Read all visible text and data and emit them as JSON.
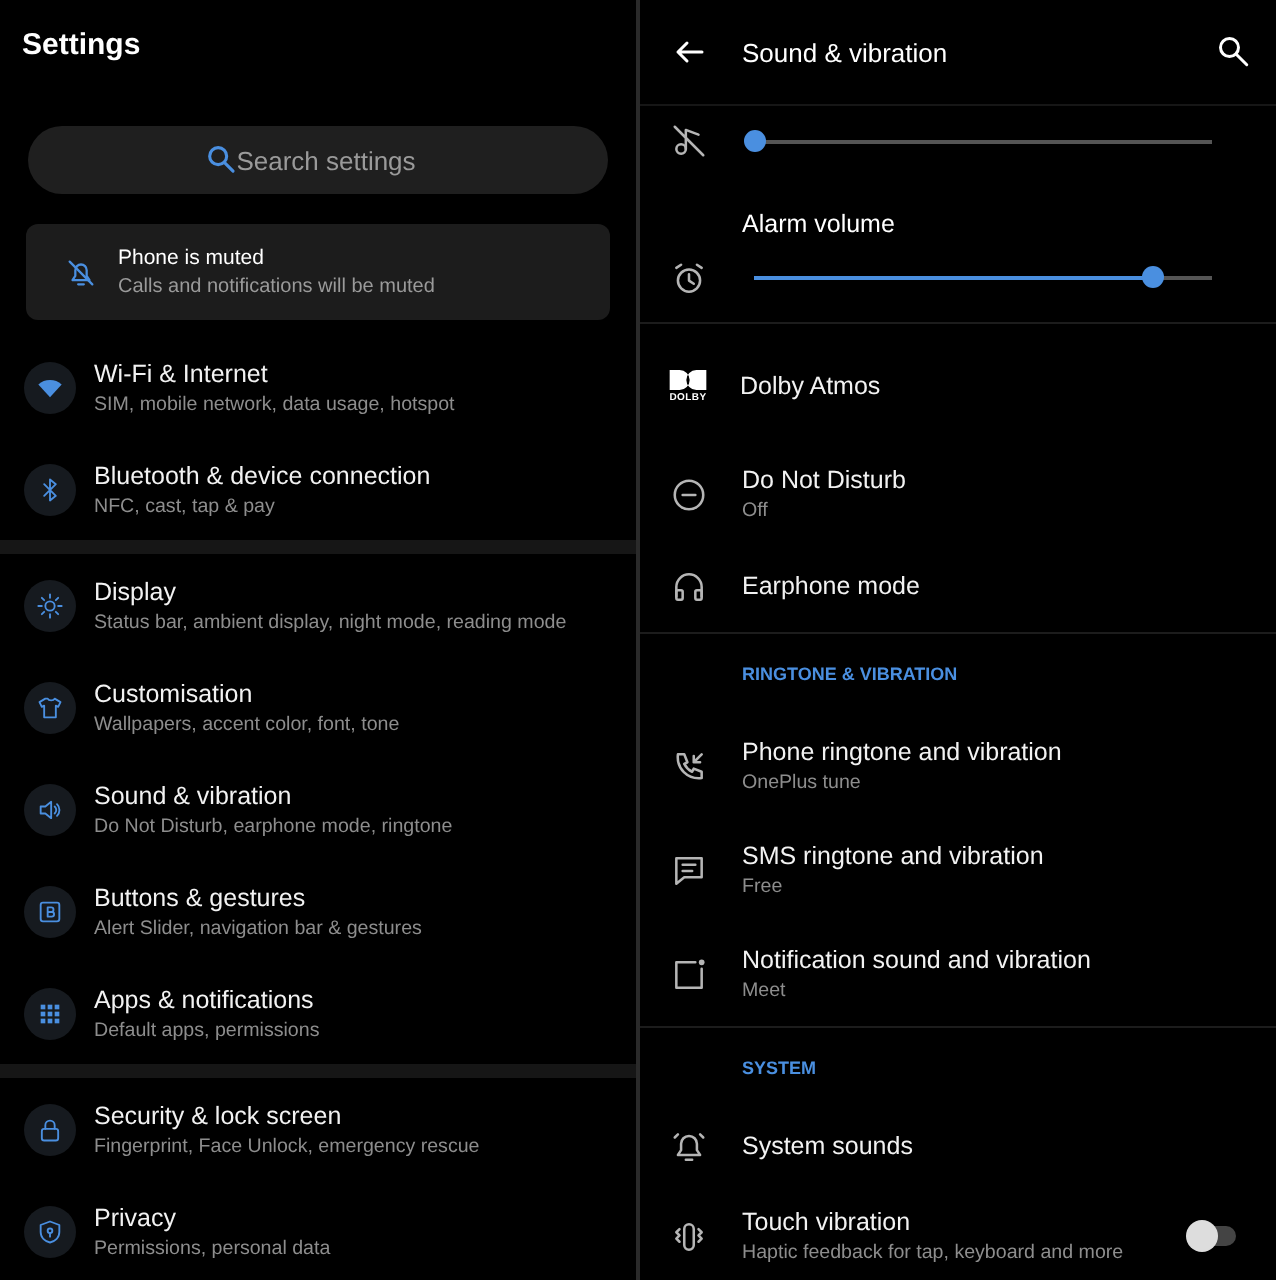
{
  "settings": {
    "title": "Settings",
    "search": {
      "placeholder": "Search settings"
    },
    "muted_banner": {
      "title": "Phone is muted",
      "subtitle": "Calls and notifications will be muted"
    },
    "groups": [
      [
        {
          "title": "Wi-Fi & Internet",
          "subtitle": "SIM, mobile network, data usage, hotspot"
        },
        {
          "title": "Bluetooth & device connection",
          "subtitle": "NFC, cast, tap & pay"
        }
      ],
      [
        {
          "title": "Display",
          "subtitle": "Status bar, ambient display, night mode, reading mode"
        },
        {
          "title": "Customisation",
          "subtitle": "Wallpapers, accent color, font, tone"
        },
        {
          "title": "Sound & vibration",
          "subtitle": "Do Not Disturb, earphone mode, ringtone"
        },
        {
          "title": "Buttons & gestures",
          "subtitle": "Alert Slider, navigation bar & gestures"
        },
        {
          "title": "Apps & notifications",
          "subtitle": "Default apps, permissions"
        }
      ],
      [
        {
          "title": "Security & lock screen",
          "subtitle": "Fingerprint, Face Unlock, emergency rescue"
        },
        {
          "title": "Privacy",
          "subtitle": "Permissions, personal data"
        }
      ]
    ]
  },
  "sound": {
    "title": "Sound & vibration",
    "sliders": [
      {
        "level": 0
      },
      {
        "label": "Alarm volume",
        "level": 0.87
      }
    ],
    "rows": [
      {
        "title": "Dolby Atmos",
        "logo_text": "DOLBY"
      },
      {
        "title": "Do Not Disturb",
        "subtitle": "Off"
      },
      {
        "title": "Earphone mode"
      }
    ],
    "sections": [
      {
        "header": "RINGTONE & VIBRATION",
        "rows": [
          {
            "title": "Phone ringtone and vibration",
            "subtitle": "OnePlus tune"
          },
          {
            "title": "SMS ringtone and vibration",
            "subtitle": "Free"
          },
          {
            "title": "Notification sound and vibration",
            "subtitle": "Meet"
          }
        ]
      },
      {
        "header": "SYSTEM",
        "rows": [
          {
            "title": "System sounds"
          },
          {
            "title": "Touch vibration",
            "subtitle": "Haptic feedback for tap, keyboard and more",
            "toggle": {
              "on": false
            }
          }
        ]
      }
    ]
  }
}
